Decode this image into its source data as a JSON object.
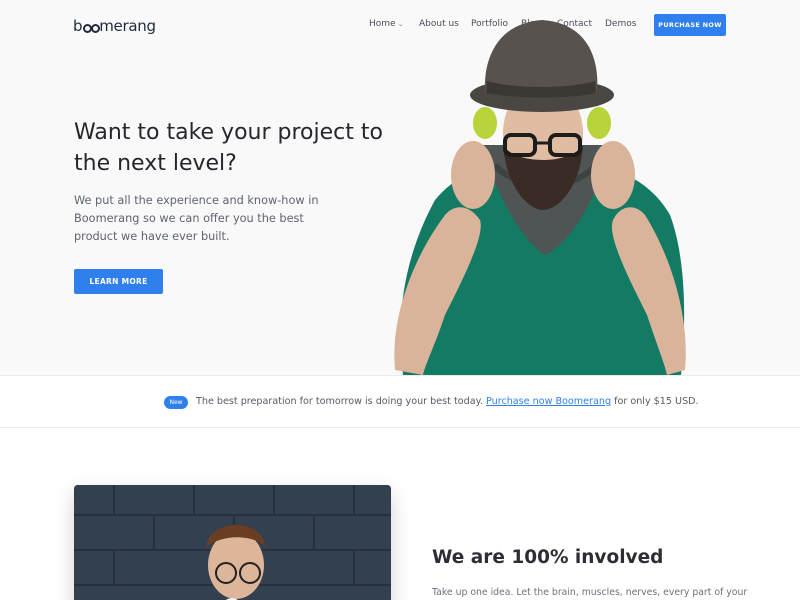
{
  "brand": {
    "logo_pre": "b",
    "logo_post": "merang"
  },
  "nav": {
    "items": [
      "Home",
      "About us",
      "Portfolio",
      "Blog",
      "Contact",
      "Demos"
    ],
    "caret": "⌄",
    "cta_label": "PURCHASE NOW"
  },
  "hero": {
    "title": "Want to take your project to the next level?",
    "text": "We put all the experience and know-how in Boomerang so we can offer you the best product we have ever built.",
    "button_label": "LEARN MORE"
  },
  "banner": {
    "badge": "New",
    "text": "The best preparation for tomorrow is doing your best today.",
    "link": "Purchase now Boomerang",
    "suffix": "for only $15 USD."
  },
  "feature": {
    "title": "We are 100% involved",
    "text": "Take up one idea. Let the brain, muscles, nerves, every part of your"
  },
  "colors": {
    "accent": "#2f80ed",
    "dark": "#24272e",
    "sweater": "#137a63"
  }
}
